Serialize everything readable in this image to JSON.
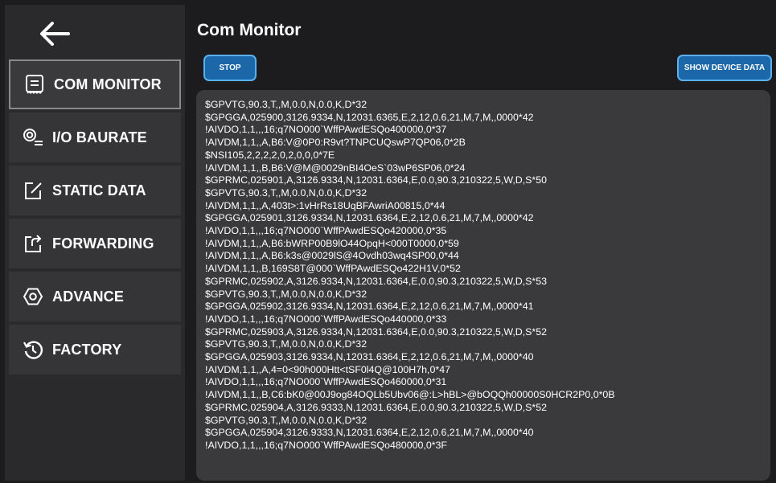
{
  "sidebar": {
    "back_icon": "back-arrow-icon",
    "items": [
      {
        "label": "COM MONITOR",
        "icon": "monitor-icon",
        "active": true
      },
      {
        "label": "I/O BAURATE",
        "icon": "io-icon"
      },
      {
        "label": "STATIC DATA",
        "icon": "edit-icon"
      },
      {
        "label": "FORWARDING",
        "icon": "forward-icon"
      },
      {
        "label": "ADVANCE",
        "icon": "hexagon-icon"
      },
      {
        "label": "FACTORY",
        "icon": "restore-icon"
      }
    ]
  },
  "main": {
    "title": "Com Monitor",
    "stop_label": "STOP",
    "show_device_label": "SHOW DEVICE DATA",
    "log_lines": [
      "$GPVTG,90.3,T,,M,0.0,N,0.0,K,D*32",
      "$GPGGA,025900,3126.9334,N,12031.6365,E,2,12,0.6,21,M,7,M,,0000*42",
      "!AIVDO,1,1,,,16;q7NO000`WffPAwdESQo400000,0*37",
      "!AIVDM,1,1,,A,B6:V@0P0:R9vt?TNPCUQswP7QP06,0*2B",
      "$NSI105,2,2,2,2,0,2,0,0,0*7E",
      "!AIVDM,1,1,,B,B6:V@M@0029nBI4OeS`03wP6SP06,0*24",
      "$GPRMC,025901,A,3126.9334,N,12031.6364,E,0.0,90.3,210322,5,W,D,S*50",
      "$GPVTG,90.3,T,,M,0.0,N,0.0,K,D*32",
      "!AIVDM,1,1,,A,403t>:1vHrRs18UqBFAwriA00815,0*44",
      "$GPGGA,025901,3126.9334,N,12031.6364,E,2,12,0.6,21,M,7,M,,0000*42",
      "!AIVDO,1,1,,,16;q7NO000`WffPAwdESQo420000,0*35",
      "!AIVDM,1,1,,A,B6:bWRP00B9lO44OpqH<000T0000,0*59",
      "!AIVDM,1,1,,A,B6:k3s@0029lS@4Ovdh03wq4SP00,0*44",
      "!AIVDM,1,1,,B,169S8T@000`WffPAwdESQo422H1V,0*52",
      "$GPRMC,025902,A,3126.9334,N,12031.6364,E,0.0,90.3,210322,5,W,D,S*53",
      "$GPVTG,90.3,T,,M,0.0,N,0.0,K,D*32",
      "$GPGGA,025902,3126.9334,N,12031.6364,E,2,12,0.6,21,M,7,M,,0000*41",
      "!AIVDO,1,1,,,16;q7NO000`WffPAwdESQo440000,0*33",
      "$GPRMC,025903,A,3126.9334,N,12031.6364,E,0.0,90.3,210322,5,W,D,S*52",
      "$GPVTG,90.3,T,,M,0.0,N,0.0,K,D*32",
      "$GPGGA,025903,3126.9334,N,12031.6364,E,2,12,0.6,21,M,7,M,,0000*40",
      "!AIVDM,1,1,,A,4=0<90h000Htt<tSF0l4Q@100H7h,0*47",
      "!AIVDO,1,1,,,16;q7NO000`WffPAwdESQo460000,0*31",
      "!AIVDM,1,1,,B,C6:bK0@00J9og84OQLb5Ubv06@:L>hBL>@bOQQh00000S0HCR2P0,0*0B",
      "$GPRMC,025904,A,3126.9333,N,12031.6364,E,0.0,90.3,210322,5,W,D,S*52",
      "$GPVTG,90.3,T,,M,0.0,N,0.0,K,D*32",
      "$GPGGA,025904,3126.9333,N,12031.6364,E,2,12,0.6,21,M,7,M,,0000*40",
      "!AIVDO,1,1,,,16;q7NO000`WffPAwdESQo480000,0*3F"
    ]
  }
}
